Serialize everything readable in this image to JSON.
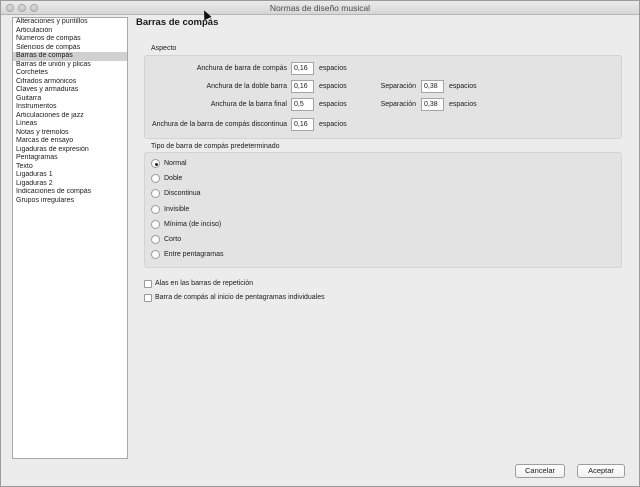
{
  "window": {
    "title": "Normas de diseño musical"
  },
  "sidebar": {
    "items": [
      "Alteraciones y puntillos",
      "Articulación",
      "Números de compás",
      "Silencios de compás",
      "Barras de compás",
      "Barras de unión y plicas",
      "Corchetes",
      "Cifrados armónicos",
      "Claves y armaduras",
      "Guitarra",
      "Instrumentos",
      "Articulaciones de jazz",
      "Líneas",
      "Notas y trémolos",
      "Marcas de ensayo",
      "Ligaduras de expresión",
      "Pentagramas",
      "Texto",
      "Ligaduras 1",
      "Ligaduras 2",
      "Indicaciones de compás",
      "Grupos irregulares"
    ],
    "selected": "Barras de compás"
  },
  "page": {
    "title": "Barras de compás"
  },
  "aspecto": {
    "label": "Aspecto",
    "rows": [
      {
        "label": "Anchura de barra de compás",
        "value": "0,16",
        "unit": "espacios"
      },
      {
        "label": "Anchura de la doble barra",
        "value": "0,16",
        "unit": "espacios",
        "sep_label": "Separación",
        "sep_value": "0,38",
        "sep_unit": "espacios"
      },
      {
        "label": "Anchura de la barra final",
        "value": "0,5",
        "unit": "espacios",
        "sep_label": "Separación",
        "sep_value": "0,38",
        "sep_unit": "espacios"
      },
      {
        "label": "Anchura de la barra de compás discontinua",
        "value": "0,16",
        "unit": "espacios"
      }
    ]
  },
  "tipo": {
    "label": "Tipo de barra de compás predeterminado",
    "options": [
      "Normal",
      "Doble",
      "Discontinua",
      "Invisible",
      "Mínima (de inciso)",
      "Corto",
      "Entre pentagramas"
    ],
    "selected": "Normal"
  },
  "checks": [
    {
      "label": "Alas en las barras de repetición",
      "checked": false
    },
    {
      "label": "Barra de compás al inicio de pentagramas individuales",
      "checked": false
    }
  ],
  "buttons": {
    "cancel": "Cancelar",
    "accept": "Aceptar"
  }
}
